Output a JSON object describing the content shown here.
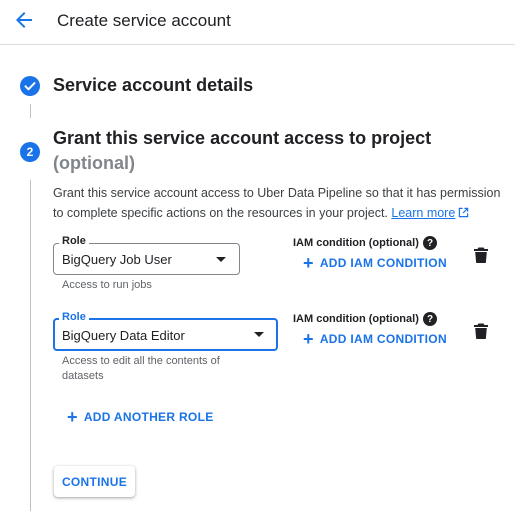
{
  "header": {
    "title": "Create service account",
    "back_icon": "arrow-left-icon"
  },
  "steps": [
    {
      "title": "Service account details",
      "status": "completed",
      "icon": "check-circle-icon"
    },
    {
      "number": "2",
      "title": "Grant this service account access to project",
      "subtitle": "(optional)"
    }
  ],
  "description": {
    "text": "Grant this service account access to Uber Data Pipeline so that it has permission to complete specific actions on the resources in your project.",
    "link_label": "Learn more",
    "link_icon": "open-in-new-icon"
  },
  "roles": [
    {
      "label": "Role",
      "value": "BigQuery Job User",
      "helper": "Access to run jobs",
      "iam_label": "IAM condition (optional)",
      "add_condition_label": "ADD IAM CONDITION",
      "focused": false
    },
    {
      "label": "Role",
      "value": "BigQuery Data Editor",
      "helper": "Access to edit all the contents of datasets",
      "iam_label": "IAM condition (optional)",
      "add_condition_label": "ADD IAM CONDITION",
      "focused": true
    }
  ],
  "add_role_label": "ADD ANOTHER ROLE",
  "continue_label": "CONTINUE",
  "colors": {
    "accent": "#1a73e8",
    "text": "#202124",
    "muted": "#5f6368",
    "subtitle": "#80868b"
  }
}
